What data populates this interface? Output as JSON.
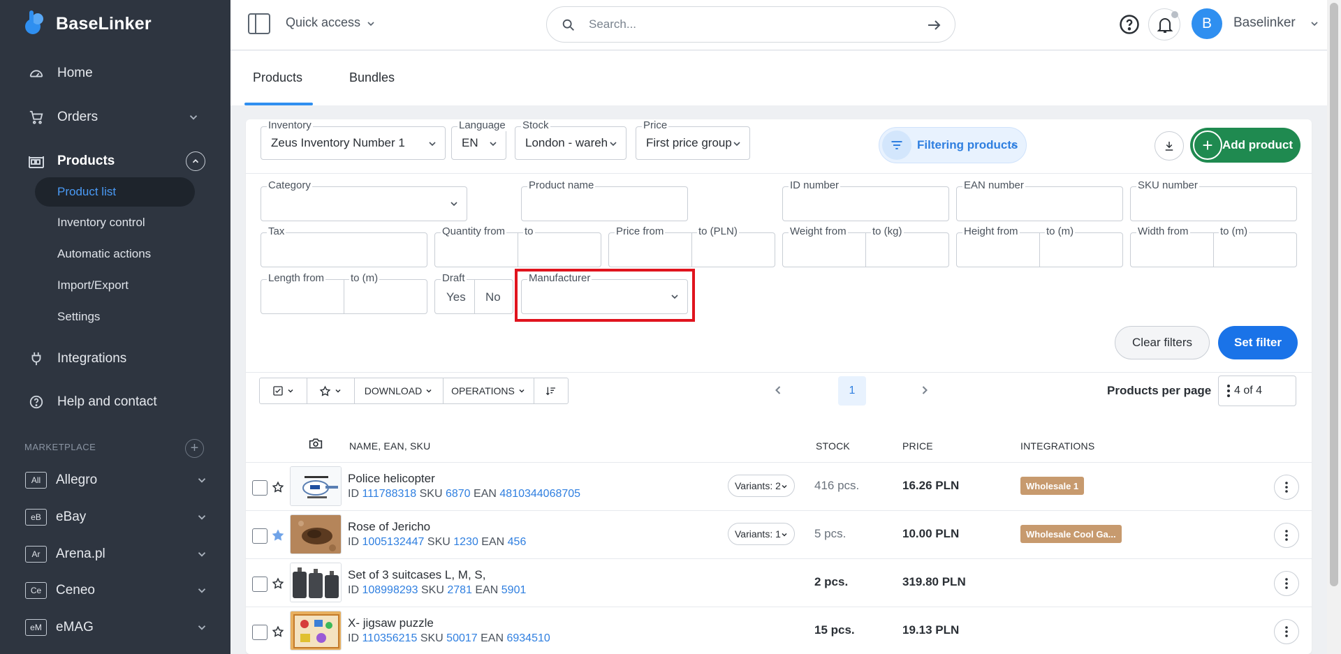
{
  "app": {
    "logo_text": "BaseLinker"
  },
  "sidebar": {
    "nav": [
      {
        "label": "Home",
        "icon": "dashboard-icon"
      },
      {
        "label": "Orders",
        "icon": "cart-icon"
      },
      {
        "label": "Products",
        "icon": "products-icon"
      },
      {
        "label": "Integrations",
        "icon": "plug-icon"
      },
      {
        "label": "Help and contact",
        "icon": "help-icon"
      }
    ],
    "products_sub": [
      "Product list",
      "Inventory control",
      "Automatic actions",
      "Import/Export",
      "Settings"
    ],
    "marketplace_label": "MARKETPLACE",
    "marketplaces": [
      {
        "badge": "All",
        "label": "Allegro"
      },
      {
        "badge": "eB",
        "label": "eBay"
      },
      {
        "badge": "Ar",
        "label": "Arena.pl"
      },
      {
        "badge": "Ce",
        "label": "Ceneo"
      },
      {
        "badge": "eM",
        "label": "eMAG"
      }
    ]
  },
  "topbar": {
    "quick_access": "Quick access",
    "search_placeholder": "Search...",
    "avatar_letter": "B",
    "user_name": "Baselinker"
  },
  "tabs": [
    "Products",
    "Bundles"
  ],
  "filters_top": {
    "inventory": {
      "label": "Inventory",
      "value": "Zeus Inventory Number 1"
    },
    "language": {
      "label": "Language",
      "value": "EN"
    },
    "stock": {
      "label": "Stock",
      "value": "London - wareh"
    },
    "price": {
      "label": "Price",
      "value": "First price group"
    },
    "filtering_toggle": "Filtering products",
    "add_product": "Add product"
  },
  "filters": {
    "category": "Category",
    "product_name": "Product name",
    "id_number": "ID number",
    "ean_number": "EAN number",
    "sku_number": "SKU number",
    "tax": "Tax",
    "quantity_from": "Quantity from",
    "quantity_to": "to",
    "price_from": "Price from",
    "price_to": "to (PLN)",
    "weight_from": "Weight from",
    "weight_to": "to (kg)",
    "height_from": "Height from",
    "height_to": "to (m)",
    "width_from": "Width from",
    "width_to": "to (m)",
    "length_from": "Length from",
    "length_to": "to (m)",
    "draft": "Draft",
    "draft_yes": "Yes",
    "draft_no": "No",
    "manufacturer": "Manufacturer",
    "clear": "Clear filters",
    "set": "Set filter"
  },
  "toolbar": {
    "download": "DOWNLOAD",
    "operations": "OPERATIONS",
    "page": "1",
    "per_page_label": "Products per page",
    "per_page_value": "4 of 4"
  },
  "table": {
    "headers": {
      "name": "NAME, EAN, SKU",
      "stock": "STOCK",
      "price": "PRICE",
      "integrations": "INTEGRATIONS"
    },
    "rows": [
      {
        "name": "Police helicopter",
        "id": "111788318",
        "sku": "6870",
        "ean": "4810344068705",
        "variants": "Variants: 2",
        "stock": "416 pcs.",
        "price": "16.26 PLN",
        "integration": "Wholesale 1",
        "starred": false
      },
      {
        "name": "Rose of Jericho",
        "id": "1005132447",
        "sku": "1230",
        "ean": "456",
        "variants": "Variants: 1",
        "stock": "5 pcs.",
        "price": "10.00 PLN",
        "integration": "Wholesale Cool Ga...",
        "starred": true
      },
      {
        "name": "Set of 3 suitcases L, M, S,",
        "id": "108998293",
        "sku": "2781",
        "ean": "5901",
        "variants": "",
        "stock": "2 pcs.",
        "price": "319.80 PLN",
        "integration": "",
        "starred": false
      },
      {
        "name": "X- jigsaw puzzle",
        "id": "110356215",
        "sku": "50017",
        "ean": "6934510",
        "variants": "",
        "stock": "15 pcs.",
        "price": "19.13 PLN",
        "integration": "",
        "starred": false
      }
    ],
    "labels": {
      "id": "ID",
      "sku": "SKU",
      "ean": "EAN"
    }
  }
}
